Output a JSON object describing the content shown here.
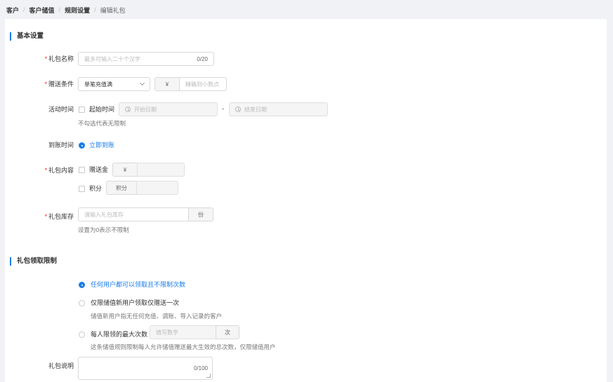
{
  "breadcrumb": [
    "客户",
    "客户储值",
    "规则设置",
    "编辑礼包"
  ],
  "sections": {
    "basic": "基本设置",
    "limit": "礼包领取限制"
  },
  "fields": {
    "name": {
      "label": "礼包名称",
      "placeholder": "最多可输入二十个汉字",
      "counter": "0/20"
    },
    "condition": {
      "label": "赠送条件",
      "select_value": "单笔充值满",
      "currency": "¥",
      "amount_placeholder": "精确到小数点"
    },
    "activity_time": {
      "label": "活动时间",
      "checkbox_label": "起始时间",
      "start_placeholder": "开始日期",
      "separator": "-",
      "end_placeholder": "结束日期",
      "hint": "不勾选代表无限制"
    },
    "arrival": {
      "label": "到账时间",
      "option": "立即到账"
    },
    "content": {
      "label": "礼包内容",
      "gift_label": "赠送金",
      "gift_currency": "¥",
      "points_label": "积分",
      "points_addon": "积分"
    },
    "stock": {
      "label": "礼包库存",
      "placeholder": "请输入礼包库存",
      "unit": "份",
      "hint": "设置为0表示不限制"
    },
    "limit": {
      "option1": "任何用户都可以领取且不限制次数",
      "option2": "仅限储值新用户领取仅赠送一次",
      "option2_hint": "储值新用户指无任何充值、调账、导入记录的客户",
      "option3": "每人限领的最大次数",
      "option3_placeholder": "填写数字",
      "option3_unit": "次",
      "option3_hint": "这条储值规则限制每人允许储值赠送最大生效的总次数，仅限储值用户"
    },
    "description": {
      "label": "礼包说明",
      "counter": "0/100"
    }
  },
  "colors": {
    "accent": "#1a7de8",
    "required": "#f5222d",
    "background": "#f0f2f5"
  }
}
